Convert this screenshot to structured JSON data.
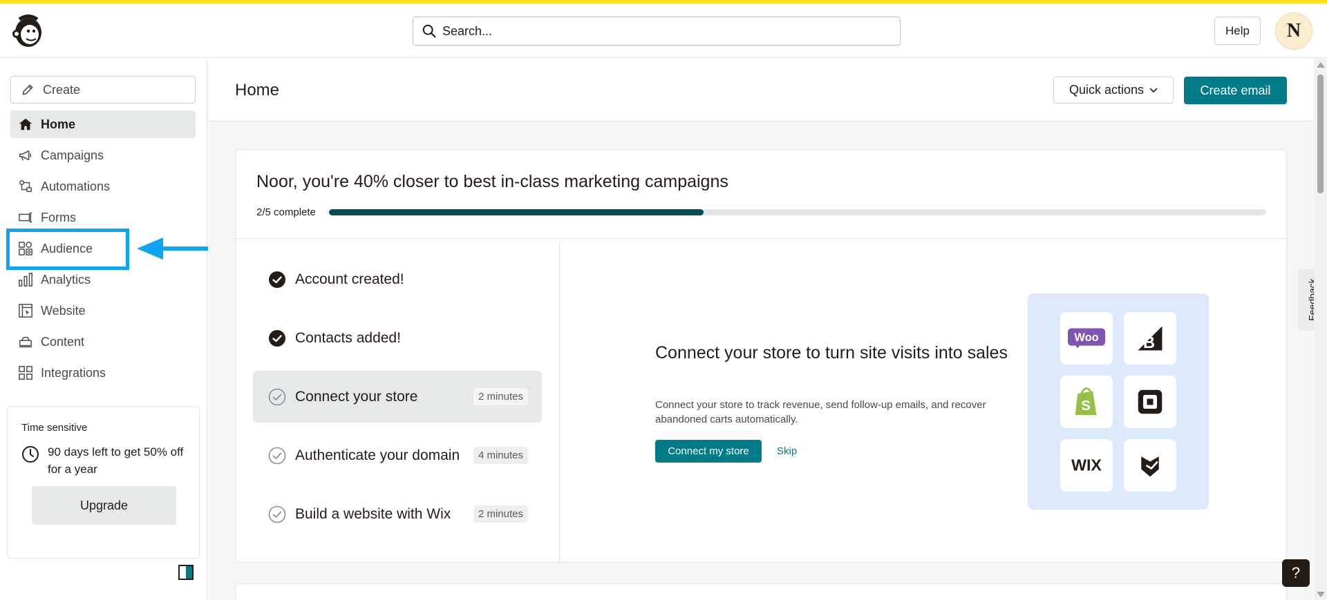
{
  "header": {
    "search_placeholder": "Search...",
    "help_label": "Help",
    "avatar_initial": "N"
  },
  "sidebar": {
    "create_label": "Create",
    "items": [
      {
        "label": "Home",
        "icon": "home-icon",
        "active": true
      },
      {
        "label": "Campaigns",
        "icon": "megaphone-icon"
      },
      {
        "label": "Automations",
        "icon": "automations-icon"
      },
      {
        "label": "Forms",
        "icon": "forms-icon"
      },
      {
        "label": "Audience",
        "icon": "audience-icon"
      },
      {
        "label": "Analytics",
        "icon": "bar-chart-icon"
      },
      {
        "label": "Website",
        "icon": "website-icon"
      },
      {
        "label": "Content",
        "icon": "content-icon"
      },
      {
        "label": "Integrations",
        "icon": "grid-icon"
      }
    ],
    "promo": {
      "title": "Time sensitive",
      "text": "90 days left to get 50% off for a year",
      "button": "Upgrade"
    }
  },
  "main": {
    "title": "Home",
    "quick_actions": "Quick actions",
    "create_email": "Create email",
    "onboarding": {
      "headline": "Noor, you're 40% closer to best in-class marketing campaigns",
      "progress_label": "2/5 complete",
      "progress_fraction": 0.4,
      "steps": [
        {
          "label": "Account created!",
          "status": "done",
          "duration": ""
        },
        {
          "label": "Contacts added!",
          "status": "done",
          "duration": ""
        },
        {
          "label": "Connect your store",
          "status": "active",
          "duration": "2 minutes"
        },
        {
          "label": "Authenticate your domain",
          "status": "todo",
          "duration": "4 minutes"
        },
        {
          "label": "Build a website with Wix",
          "status": "todo",
          "duration": "2 minutes"
        }
      ],
      "detail": {
        "title": "Connect your store to turn site visits into sales",
        "description": "Connect your store to track revenue, send follow-up emails, and recover abandoned carts automatically.",
        "primary_button": "Connect my store",
        "skip": "Skip",
        "logos": [
          "woo",
          "bigcommerce",
          "shopify",
          "square",
          "wix",
          "squarespace"
        ],
        "logo_texts": {
          "woo": "Woo",
          "wix": "WIX"
        }
      }
    }
  },
  "feedback_label": "Feedback",
  "help_float": "?",
  "colors": {
    "brand_yellow": "#ffe01b",
    "accent_teal": "#007c89",
    "progress_fill": "#004e56",
    "highlight_blue": "#0ea5f0"
  }
}
